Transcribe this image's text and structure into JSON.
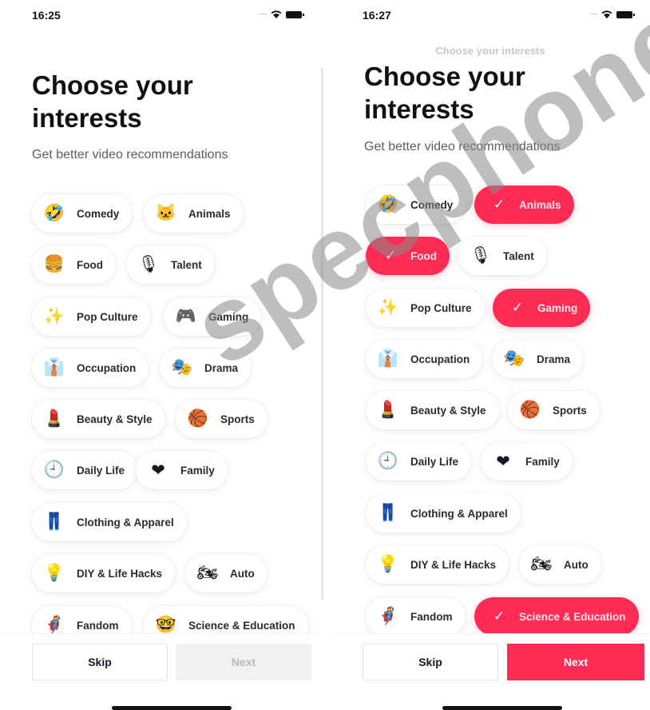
{
  "left_screen": {
    "status_time": "16:25",
    "title": "Choose your interests",
    "subtitle": "Get better video recommendations",
    "chips": [
      {
        "label": "Comedy",
        "icon": "🤣",
        "icon_name": "laughing-face-icon",
        "selected": false
      },
      {
        "label": "Animals",
        "icon": "🐱",
        "icon_name": "cat-face-icon",
        "selected": false
      },
      {
        "label": "Food",
        "icon": "🍔",
        "icon_name": "burger-icon",
        "selected": false
      },
      {
        "label": "Talent",
        "icon": "🎙",
        "icon_name": "microphone-icon",
        "selected": false
      },
      {
        "label": "Pop Culture",
        "icon": "✨",
        "icon_name": "sparkles-icon",
        "selected": false
      },
      {
        "label": "Gaming",
        "icon": "🎮",
        "icon_name": "game-controller-icon",
        "selected": false
      },
      {
        "label": "Occupation",
        "icon": "👔",
        "icon_name": "necktie-icon",
        "selected": false
      },
      {
        "label": "Drama",
        "icon": "🎭",
        "icon_name": "drama-masks-icon",
        "selected": false
      },
      {
        "label": "Beauty & Style",
        "icon": "💄",
        "icon_name": "lipstick-icon",
        "selected": false
      },
      {
        "label": "Sports",
        "icon": "🏀",
        "icon_name": "basketball-icon",
        "selected": false
      },
      {
        "label": "Daily Life",
        "icon": "🕘",
        "icon_name": "clock-icon",
        "selected": false
      },
      {
        "label": "Family",
        "icon": "❤",
        "icon_name": "heart-icon",
        "selected": false
      },
      {
        "label": "Clothing & Apparel",
        "icon": "👖",
        "icon_name": "jeans-icon",
        "selected": false
      },
      {
        "label": "DIY & Life Hacks",
        "icon": "💡",
        "icon_name": "light-bulb-icon",
        "selected": false
      },
      {
        "label": "Auto",
        "icon": "🏍",
        "icon_name": "motorcycle-icon",
        "selected": false
      },
      {
        "label": "Fandom",
        "icon": "🦸",
        "icon_name": "superhero-icon",
        "selected": false
      },
      {
        "label": "Science & Education",
        "icon": "🤓",
        "icon_name": "nerd-face-icon",
        "selected": false
      }
    ],
    "skip_label": "Skip",
    "next_label": "Next",
    "next_enabled": false
  },
  "right_screen": {
    "status_time": "16:27",
    "nav_title": "Choose your interests",
    "title": "Choose your interests",
    "subtitle": "Get better video recommendations",
    "chips": [
      {
        "label": "Comedy",
        "icon": "🤣",
        "icon_name": "laughing-face-icon",
        "selected": false
      },
      {
        "label": "Animals",
        "icon": "✓",
        "icon_name": "check-icon",
        "selected": true
      },
      {
        "label": "Food",
        "icon": "✓",
        "icon_name": "check-icon",
        "selected": true
      },
      {
        "label": "Talent",
        "icon": "🎙",
        "icon_name": "microphone-icon",
        "selected": false
      },
      {
        "label": "Pop Culture",
        "icon": "✨",
        "icon_name": "sparkles-icon",
        "selected": false
      },
      {
        "label": "Gaming",
        "icon": "✓",
        "icon_name": "check-icon",
        "selected": true
      },
      {
        "label": "Occupation",
        "icon": "👔",
        "icon_name": "necktie-icon",
        "selected": false
      },
      {
        "label": "Drama",
        "icon": "🎭",
        "icon_name": "drama-masks-icon",
        "selected": false
      },
      {
        "label": "Beauty & Style",
        "icon": "💄",
        "icon_name": "lipstick-icon",
        "selected": false
      },
      {
        "label": "Sports",
        "icon": "🏀",
        "icon_name": "basketball-icon",
        "selected": false
      },
      {
        "label": "Daily Life",
        "icon": "🕘",
        "icon_name": "clock-icon",
        "selected": false
      },
      {
        "label": "Family",
        "icon": "❤",
        "icon_name": "heart-icon",
        "selected": false
      },
      {
        "label": "Clothing & Apparel",
        "icon": "👖",
        "icon_name": "jeans-icon",
        "selected": false
      },
      {
        "label": "DIY & Life Hacks",
        "icon": "💡",
        "icon_name": "light-bulb-icon",
        "selected": false
      },
      {
        "label": "Auto",
        "icon": "🏍",
        "icon_name": "motorcycle-icon",
        "selected": false
      },
      {
        "label": "Fandom",
        "icon": "🦸",
        "icon_name": "superhero-icon",
        "selected": false
      },
      {
        "label": "Science & Education",
        "icon": "✓",
        "icon_name": "check-icon",
        "selected": true
      }
    ],
    "skip_label": "Skip",
    "next_label": "Next",
    "next_enabled": true
  },
  "watermark": "specphone",
  "colors": {
    "accent": "#fe2c55",
    "chip_bg": "#ffffff",
    "next_disabled_bg": "#f1f1f2"
  }
}
